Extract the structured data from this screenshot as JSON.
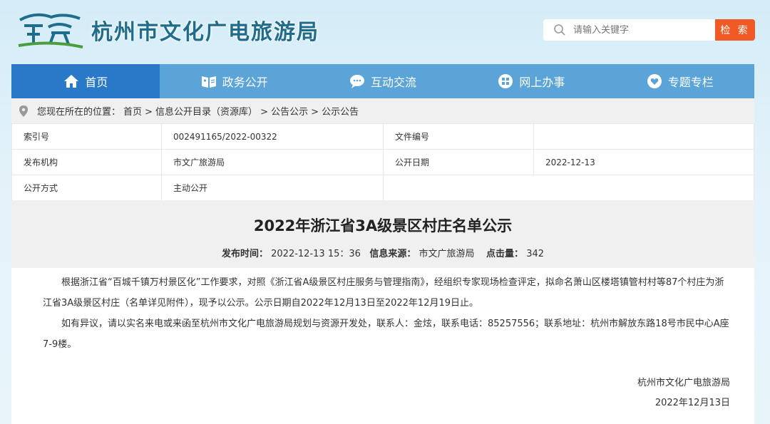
{
  "header": {
    "site_title": "杭州市文化广电旅游局",
    "search_placeholder": "请输入关键字",
    "search_button": "检 索"
  },
  "nav": {
    "items": [
      {
        "label": "首页",
        "icon": "home-icon"
      },
      {
        "label": "政务公开",
        "icon": "card-icon"
      },
      {
        "label": "互动交流",
        "icon": "chat-icon"
      },
      {
        "label": "网上办事",
        "icon": "grid-icon"
      },
      {
        "label": "专题专栏",
        "icon": "heart-icon"
      }
    ],
    "active": 0
  },
  "breadcrumb": {
    "prefix": "您现在所在的位置：",
    "items": [
      "首页",
      "> 信息公开目录（资源库）",
      "> 公告公示",
      "> 公示公告"
    ]
  },
  "meta": {
    "index_label": "索引号",
    "index_value": "002491165/2022-00322",
    "doc_no_label": "文件编号",
    "doc_no_value": "",
    "org_label": "发布机构",
    "org_value": "市文广旅游局",
    "date_label": "公开日期",
    "date_value": "2022-12-13",
    "mode_label": "公开方式",
    "mode_value": "主动公开"
  },
  "article": {
    "title": "2022年浙江省3A级景区村庄名单公示",
    "publish_label": "发布时间：",
    "publish_time": "2022-12-13 15：36",
    "source_label": "信息来源：",
    "source": "市文广旅游局",
    "hits_label": "点击量：",
    "hits": "342",
    "para1": "根据浙江省“百城千镇万村景区化”工作要求，对照《浙江省A级景区村庄服务与管理指南》，经组织专家现场检查评定，拟命名萧山区楼塔镇管村村等87个村庄为浙江省3A级景区村庄（名单详见附件），现予以公示。公示日期自2022年12月13日至2022年12月19日止。",
    "para2": "如有异议，请以实名来电或来函至杭州市文化广电旅游局规划与资源开发处，联系人：金炫，联系电话：85257556；联系地址：杭州市解放东路18号市民中心A座7-9楼。",
    "sign_org": "杭州市文化广电旅游局",
    "sign_date": "2022年12月13日"
  },
  "colors": {
    "nav_bg": "#5aa4d8",
    "nav_active": "#2a78c8",
    "search_button": "#f15a24",
    "title_color": "#1f6c8c"
  }
}
